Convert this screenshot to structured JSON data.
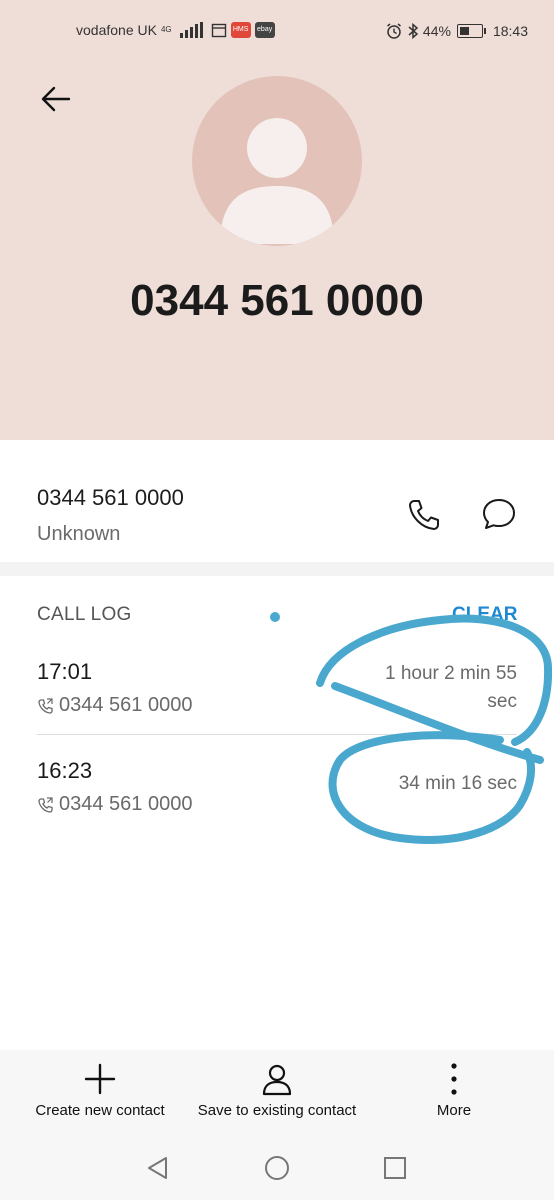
{
  "status_bar": {
    "carrier": "vodafone UK",
    "network": "4G",
    "app_badges": [
      "HMS",
      "ebay"
    ],
    "battery": "44%",
    "battery_level": 0.44,
    "time": "18:43"
  },
  "header": {
    "number": "0344 561 0000"
  },
  "contact": {
    "number": "0344 561 0000",
    "label": "Unknown"
  },
  "call_log": {
    "title": "CALL LOG",
    "clear_label": "CLEAR",
    "entries": [
      {
        "time": "17:01",
        "number": "0344 561 0000",
        "duration_line1": "1 hour 2 min 55",
        "duration_line2": "sec"
      },
      {
        "time": "16:23",
        "number": "0344 561 0000",
        "duration_line1": "34 min 16 sec",
        "duration_line2": ""
      }
    ]
  },
  "actions": {
    "create_new": "Create new contact",
    "save_existing": "Save to existing contact",
    "more": "More"
  },
  "colors": {
    "header_bg": "#efded8",
    "accent": "#1e88d2",
    "annotation": "#4aa8cf"
  }
}
